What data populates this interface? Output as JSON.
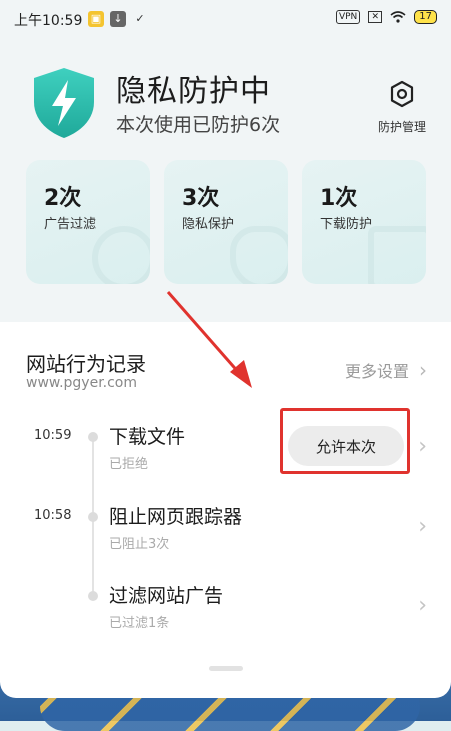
{
  "status_bar": {
    "time": "上午10:59",
    "vpn": "VPN",
    "battery": "17"
  },
  "hero": {
    "title": "隐私防护中",
    "subtitle": "本次使用已防护6次",
    "manage_label": "防护管理"
  },
  "cards": [
    {
      "count": "2次",
      "label": "广告过滤"
    },
    {
      "count": "3次",
      "label": "隐私保护"
    },
    {
      "count": "1次",
      "label": "下载防护"
    }
  ],
  "section": {
    "title": "网站行为记录",
    "url": "www.pgyer.com",
    "more_label": "更多设置"
  },
  "records": [
    {
      "time": "10:59",
      "title": "下载文件",
      "status": "已拒绝",
      "action": "允许本次"
    },
    {
      "time": "10:58",
      "title": "阻止网页跟踪器",
      "status": "已阻止3次"
    },
    {
      "time": "",
      "title": "过滤网站广告",
      "status": "已过滤1条"
    }
  ],
  "colors": {
    "accent": "#2fc1b0",
    "highlight_box": "#e0332e"
  }
}
